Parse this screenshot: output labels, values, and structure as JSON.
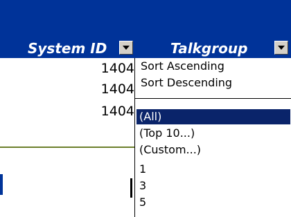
{
  "header": {
    "columns": [
      {
        "label": "System ID"
      },
      {
        "label": "Talkgroup"
      }
    ]
  },
  "cells": [
    "1404",
    "1404",
    "1404"
  ],
  "dropdown": {
    "sort_items": [
      "Sort Ascending",
      "Sort Descending"
    ],
    "list_items": [
      "(All)",
      "(Top 10...)",
      "(Custom...)",
      "1",
      "3",
      "5"
    ],
    "selected_index": 0,
    "selected_color": "#0a246a"
  },
  "colors": {
    "header_bg": "#003399",
    "header_text": "#ffffff",
    "accent_line": "#6b7f2a"
  },
  "icons": {
    "dropdown_button": "chevron-down-icon"
  }
}
